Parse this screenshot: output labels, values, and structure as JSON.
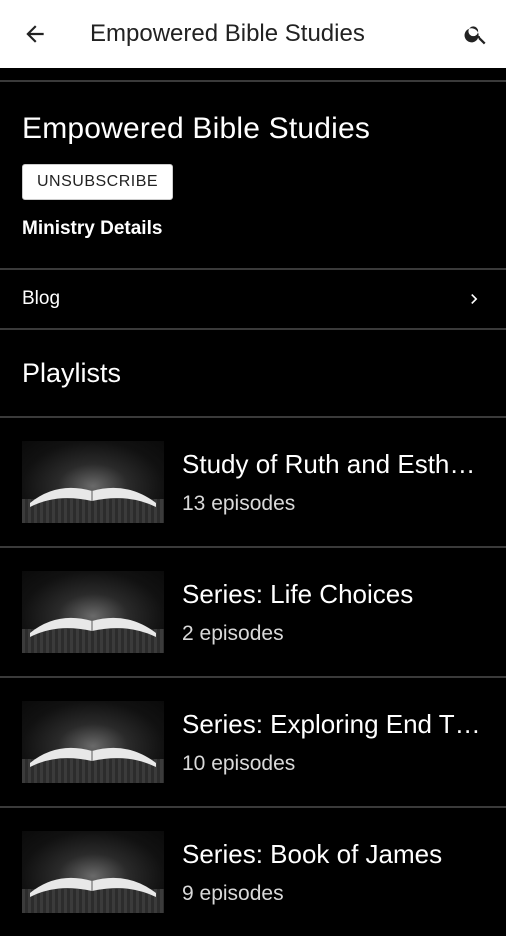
{
  "appbar": {
    "title": "Empowered Bible Studies",
    "back_icon": "arrow-left-icon",
    "search_icon": "search-icon"
  },
  "ministry": {
    "name": "Empowered Bible Studies",
    "unsubscribe_label": "UNSUBSCRIBE",
    "details_label": "Ministry Details"
  },
  "links": [
    {
      "label": "Blog",
      "icon": "chevron-right-icon"
    }
  ],
  "playlists_title": "Playlists",
  "playlists": [
    {
      "title": "Study of Ruth and Esth…",
      "count": "13 episodes"
    },
    {
      "title": "Series: Life Choices",
      "count": "2 episodes"
    },
    {
      "title": "Series: Exploring End T…",
      "count": "10 episodes"
    },
    {
      "title": "Series: Book of James",
      "count": "9 episodes"
    }
  ],
  "colors": {
    "background": "#000000",
    "appbar": "#ffffff",
    "divider": "#3a3a3a"
  }
}
